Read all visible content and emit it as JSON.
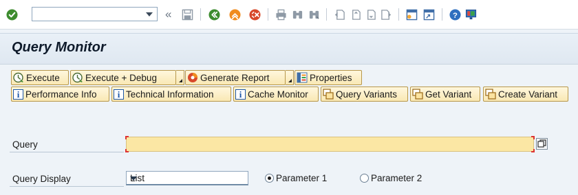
{
  "toolbar": {
    "command_field_value": "",
    "icons": [
      "enter-icon",
      "back-double-arrow-icon",
      "save-icon",
      "back-icon",
      "exit-icon",
      "cancel-icon",
      "print-icon",
      "find-icon",
      "find-next-icon",
      "first-page-icon",
      "previous-page-icon",
      "next-page-icon",
      "last-page-icon",
      "create-session-icon",
      "shortcut-icon",
      "help-icon",
      "customize-layout-icon"
    ]
  },
  "title": "Query Monitor",
  "buttons": {
    "execute": "Execute",
    "execute_debug": "Execute + Debug",
    "generate_report": "Generate Report",
    "properties": "Properties",
    "performance_info": "Performance Info",
    "technical_information": "Technical Information",
    "cache_monitor": "Cache Monitor",
    "query_variants": "Query Variants",
    "get_variant": "Get Variant",
    "create_variant": "Create Variant"
  },
  "form": {
    "query_label": "Query",
    "query_value": "",
    "query_display_label": "Query Display",
    "query_display_value": "List",
    "radio_1_label": "Parameter 1",
    "radio_1_selected": true,
    "radio_2_label": "Parameter 2",
    "radio_2_selected": false
  },
  "colors": {
    "button_bg": "#f9e8b4",
    "required_field_bg": "#fbe7a4",
    "title_bg": "#e4ecf4",
    "green_icon": "#3d8c2e",
    "orange_icon": "#f08c1e",
    "red_icon": "#d7482b"
  }
}
